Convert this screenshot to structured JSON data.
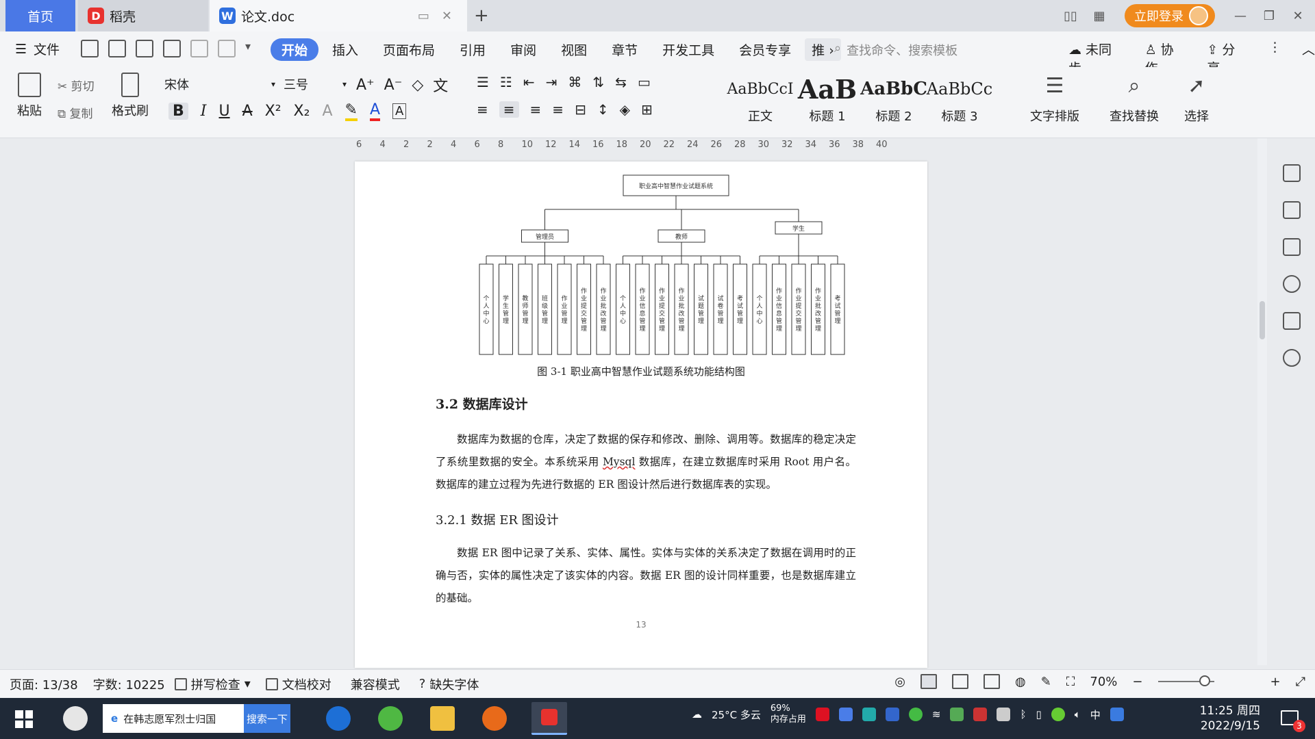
{
  "tabs": {
    "home": "首页",
    "daoke": "稻壳",
    "doc": "论文.doc"
  },
  "window": {
    "login": "立即登录"
  },
  "menu": {
    "file": "文件",
    "tabs": [
      "开始",
      "插入",
      "页面布局",
      "引用",
      "审阅",
      "视图",
      "章节",
      "开发工具",
      "会员专享",
      "推"
    ],
    "active_tab": "开始",
    "search_placeholder": "查找命令、搜索模板",
    "sync": "未同步",
    "collab": "协作",
    "share": "分享"
  },
  "ribbon": {
    "paste": "粘贴",
    "cut": "剪切",
    "copy": "复制",
    "format_painter": "格式刷",
    "font": "宋体",
    "size": "三号",
    "styles": [
      {
        "sample": "AaBbCcI",
        "name": "正文"
      },
      {
        "sample": "AaB",
        "name": "标题 1"
      },
      {
        "sample": "AaBbC",
        "name": "标题 2"
      },
      {
        "sample": "AaBbCc",
        "name": "标题 3"
      }
    ],
    "text_layout": "文字排版",
    "find_replace": "查找替换",
    "select": "选择"
  },
  "ruler": [
    "6",
    "4",
    "2",
    "2",
    "4",
    "6",
    "8",
    "10",
    "12",
    "14",
    "16",
    "18",
    "20",
    "22",
    "24",
    "26",
    "28",
    "30",
    "32",
    "34",
    "36",
    "38",
    "40"
  ],
  "document": {
    "figure": {
      "root": "职业高中智慧作业试题系统",
      "groups": [
        {
          "name": "管理员",
          "items": [
            "个人中心",
            "学生管理",
            "教师管理",
            "班级管理",
            "作业管理",
            "作业提交管理",
            "作业批改管理"
          ]
        },
        {
          "name": "教师",
          "items": [
            "个人中心",
            "作业信息管理",
            "作业提交管理",
            "作业批改管理",
            "试题管理",
            "试卷管理",
            "考试管理"
          ]
        },
        {
          "name": "学生",
          "items": [
            "个人中心",
            "作业信息管理",
            "作业提交管理",
            "作业批改管理",
            "考试管理"
          ]
        }
      ]
    },
    "caption": "图 3-1 职业高中智慧作业试题系统功能结构图",
    "heading_32": "3.2 数据库设计",
    "para1_a": "数据库为数据的仓库，决定了数据的保存和修改、删除、调用等。数据库的稳定决定了系统里数据的安全。本系统采用 ",
    "para1_mysql": "Mysql",
    "para1_b": " 数据库，在建立数据库时采用 Root 用户名。数据库的建立过程为先进行数据的 ER 图设计然后进行数据库表的实现。",
    "heading_321": "3.2.1 数据 ER 图设计",
    "para2": "数据 ER 图中记录了关系、实体、属性。实体与实体的关系决定了数据在调用时的正确与否，实体的属性决定了该实体的内容。数据 ER 图的设计同样重要，也是数据库建立的基础。",
    "page_number": "13"
  },
  "status": {
    "page": "页面: 13/38",
    "words": "字数: 10225",
    "spell": "拼写检查",
    "proof": "文档校对",
    "compat": "兼容模式",
    "missing_font": "缺失字体",
    "zoom": "70%"
  },
  "taskbar": {
    "search_text": "在韩志愿军烈士归国",
    "search_btn": "搜索一下",
    "weather": "25°C 多云",
    "memory_pct": "69%",
    "memory_label": "内存占用",
    "ime": "中",
    "time": "11:25 周四",
    "date": "2022/9/15",
    "notify_count": "3"
  },
  "colors": {
    "accent": "#4a7de8",
    "login": "#f08a1d",
    "taskbar": "#1f2937"
  }
}
